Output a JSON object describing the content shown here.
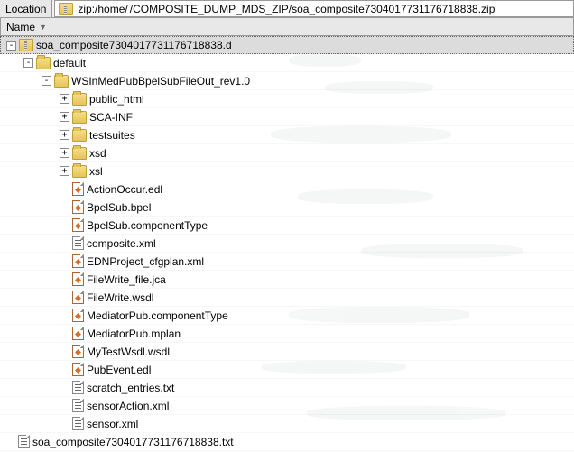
{
  "location": {
    "label": "Location",
    "prefix": "zip:/home/",
    "path": "/COMPOSITE_DUMP_MDS_ZIP/soa_composite7304017731176718838.zip"
  },
  "columns": {
    "name": "Name"
  },
  "tree": {
    "root": "soa_composite7304017731176718838.d",
    "default": "default",
    "composite": "WSInMedPubBpelSubFileOut_rev1.0",
    "folders": [
      "public_html",
      "SCA-INF",
      "testsuites",
      "xsd",
      "xsl"
    ],
    "files": [
      "ActionOccur.edl",
      "BpelSub.bpel",
      "BpelSub.componentType",
      "composite.xml",
      "EDNProject_cfgplan.xml",
      "FileWrite_file.jca",
      "FileWrite.wsdl",
      "MediatorPub.componentType",
      "MediatorPub.mplan",
      "MyTestWsdl.wsdl",
      "PubEvent.edl",
      "scratch_entries.txt",
      "sensorAction.xml",
      "sensor.xml"
    ],
    "sibling": "soa_composite7304017731176718838.txt"
  },
  "file_icons": {
    "ActionOccur.edl": "x",
    "BpelSub.bpel": "x",
    "BpelSub.componentType": "x",
    "composite.xml": "txt",
    "EDNProject_cfgplan.xml": "x",
    "FileWrite_file.jca": "x",
    "FileWrite.wsdl": "x",
    "MediatorPub.componentType": "x",
    "MediatorPub.mplan": "x",
    "MyTestWsdl.wsdl": "x",
    "PubEvent.edl": "x",
    "scratch_entries.txt": "txt",
    "sensorAction.xml": "txt",
    "sensor.xml": "txt"
  }
}
